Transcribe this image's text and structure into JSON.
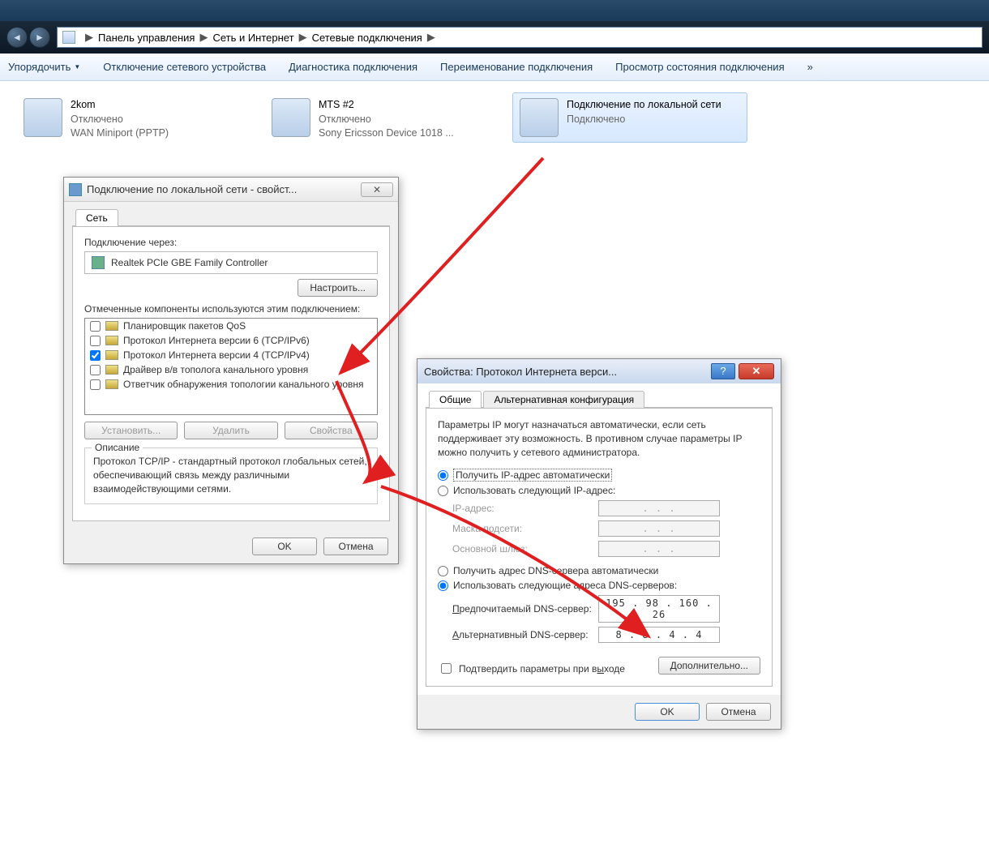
{
  "breadcrumb": {
    "root": "Панель управления",
    "level1": "Сеть и Интернет",
    "level2": "Сетевые подключения"
  },
  "toolbar": {
    "organize": "Упорядочить",
    "disable": "Отключение сетевого устройства",
    "diagnose": "Диагностика подключения",
    "rename": "Переименование подключения",
    "view_status": "Просмотр состояния подключения",
    "more": "»"
  },
  "connections": [
    {
      "title": "2kom",
      "status": "Отключено",
      "device": "WAN Miniport (PPTP)"
    },
    {
      "title": "MTS #2",
      "status": "Отключено",
      "device": "Sony Ericsson Device 1018 ..."
    },
    {
      "title": "Подключение по локальной сети",
      "status": "Подключено",
      "device": ""
    }
  ],
  "dialog1": {
    "title": "Подключение по локальной сети - свойст...",
    "tab_network": "Сеть",
    "connect_using_label": "Подключение через:",
    "adapter": "Realtek PCIe GBE Family Controller",
    "configure_btn": "Настроить...",
    "components_label": "Отмеченные компоненты используются этим подключением:",
    "items": [
      {
        "checked": false,
        "label": "Планировщик пакетов QoS"
      },
      {
        "checked": false,
        "label": "Протокол Интернета версии 6 (TCP/IPv6)"
      },
      {
        "checked": true,
        "label": "Протокол Интернета версии 4 (TCP/IPv4)"
      },
      {
        "checked": false,
        "label": "Драйвер в/в тополога канального уровня"
      },
      {
        "checked": false,
        "label": "Ответчик обнаружения топологии канального уровня"
      }
    ],
    "install_btn": "Установить...",
    "remove_btn": "Удалить",
    "props_btn": "Свойства",
    "desc_title": "Описание",
    "desc_text": "Протокол TCP/IP - стандартный протокол глобальных сетей, обеспечивающий связь между различными взаимодействующими сетями.",
    "ok_btn": "OK",
    "cancel_btn": "Отмена"
  },
  "dialog2": {
    "title": "Свойства: Протокол Интернета верси...",
    "tab_general": "Общие",
    "tab_alt": "Альтернативная конфигурация",
    "info": "Параметры IP могут назначаться автоматически, если сеть поддерживает эту возможность. В противном случае параметры IP можно получить у сетевого администратора.",
    "radio_ip_auto": "Получить IP-адрес автоматически",
    "radio_ip_manual": "Использовать следующий IP-адрес:",
    "ip_label": "IP-адрес:",
    "mask_label": "Маска подсети:",
    "gateway_label": "Основной шлюз:",
    "ip_dots": ".       .       .",
    "radio_dns_auto": "Получить адрес DNS-сервера автоматически",
    "radio_dns_manual": "Использовать следующие адреса DNS-серверов:",
    "dns_pref_label": "Предпочитаемый DNS-сервер:",
    "dns_alt_label": "Альтернативный DNS-сервер:",
    "dns_pref_value": "195 . 98 . 160 . 26",
    "dns_alt_value": "8  .  8  .  4  .  4",
    "confirm_label": "Подтвердить параметры при выходе",
    "advanced_btn": "Дополнительно...",
    "ok_btn": "OK",
    "cancel_btn": "Отмена"
  }
}
